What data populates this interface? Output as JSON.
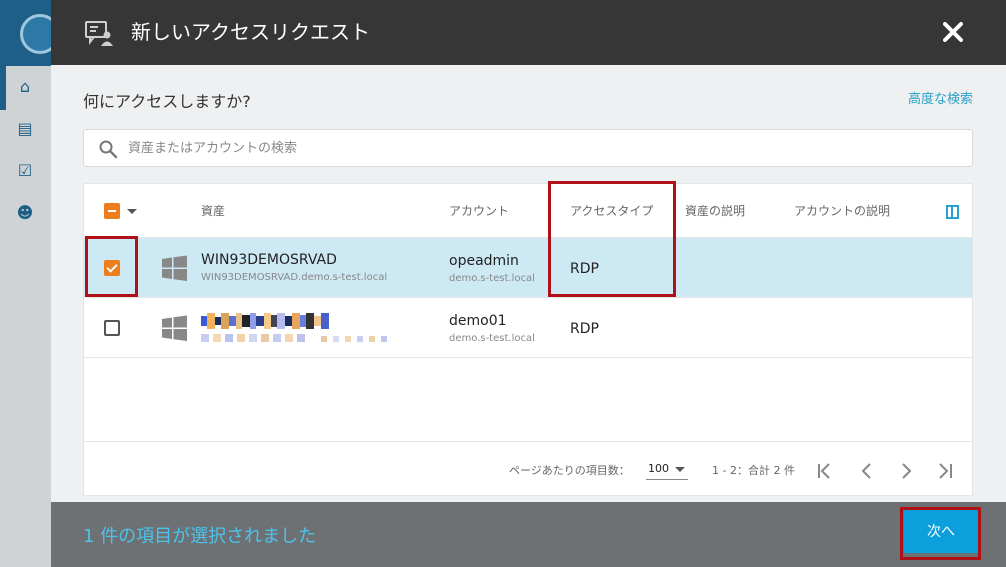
{
  "modal": {
    "title": "新しいアクセスリクエスト",
    "question": "何にアクセスしますか?",
    "advanced_search": "高度な検索",
    "search_placeholder": "資産またはアカウントの検索"
  },
  "table": {
    "headers": {
      "asset": "資産",
      "account": "アカウント",
      "access_type": "アクセスタイプ",
      "asset_desc": "資産の説明",
      "account_desc": "アカウントの説明"
    },
    "rows": [
      {
        "selected": true,
        "asset_name": "WIN93DEMOSRVAD",
        "asset_fqdn": "WIN93DEMOSRVAD.demo.s-test.local",
        "account_name": "opeadmin",
        "account_domain": "demo.s-test.local",
        "access_type": "RDP"
      },
      {
        "selected": false,
        "asset_name": "",
        "asset_fqdn": "",
        "account_name": "demo01",
        "account_domain": "demo.s-test.local",
        "access_type": "RDP"
      }
    ]
  },
  "pager": {
    "per_page_label": "ページあたりの項目数：",
    "per_page_value": "100",
    "range_text": "1 - 2：合計 2 件"
  },
  "footer": {
    "selected_text": "1 件の項目が選択されました",
    "next_label": "次へ"
  },
  "colors": {
    "accent": "#0d9fdb",
    "checkbox": "#ee7d1e",
    "selected_row": "#cde9f4",
    "highlight": "#b01117"
  }
}
